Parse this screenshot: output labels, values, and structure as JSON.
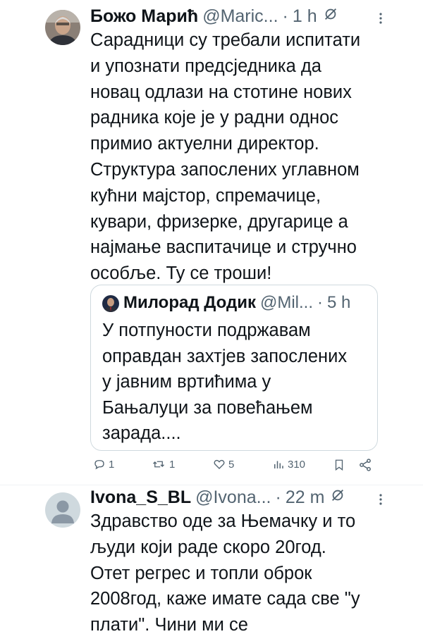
{
  "tweet1": {
    "author_name": "Божо Марић",
    "handle": "@Maric...",
    "separator": "·",
    "time": "1 h",
    "body_lines": [
      "Сарадници су требали испитати",
      "и упознати предсједника да",
      "новац одлази на стотине нових",
      "радника које је у радни однос",
      "примио актуелни директор.",
      "Структура запослених углавном",
      "кућни мајстор, спремачице,",
      "кувари, фризерке, другарице а",
      "најмање васпитачице и стручно",
      "особље. Ту се троши!"
    ],
    "quote": {
      "author_name": "Милорад Додик",
      "handle": "@Mil...",
      "separator": "·",
      "time": "5 h",
      "body_lines": [
        "У потпуности подржавам",
        "оправдан захтјев запослених",
        "у јавним вртићима у",
        "Бањалуци за повећањем",
        "зарада...."
      ]
    },
    "actions": {
      "replies": "1",
      "retweets": "1",
      "likes": "5",
      "views": "310"
    }
  },
  "tweet2": {
    "author_name": "Ivona_S_BL",
    "handle": "@Ivona...",
    "separator": "·",
    "time": "22 m",
    "body_lines": [
      "Здравство оде за Њемачку и то",
      "људи који раде скоро 20год.",
      "Отет регрес и топли оброк",
      "2008год, каже имате сада све \"у",
      "плати\". Чини ми се"
    ]
  },
  "colors": {
    "text": "#0f1419",
    "secondary": "#536471",
    "border": "#cfd9de",
    "divider": "#eff3f4",
    "default_avatar": "#cfd9de"
  },
  "icons": [
    "grok-icon",
    "more-icon",
    "reply-icon",
    "retweet-icon",
    "like-icon",
    "views-icon",
    "bookmark-icon",
    "share-icon"
  ]
}
